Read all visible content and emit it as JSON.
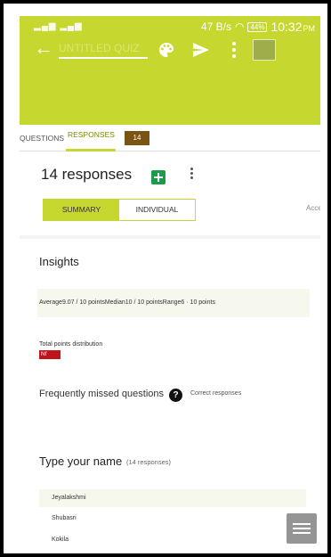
{
  "status": {
    "speed": "47 B/s",
    "battery": "44%",
    "time": "10:32",
    "ampm": "PM"
  },
  "toolbar": {
    "title": "UNTITLED QUIZ"
  },
  "tabs": {
    "questions": "QUESTIONS",
    "responses": "RESPONSES",
    "responses_count": "14"
  },
  "summary": {
    "heading": "14 responses",
    "summary_button": "SUMMARY",
    "individual_button": "INDIVIDUAL",
    "accepting_text": "Acce"
  },
  "insights": {
    "title": "Insights",
    "stats": "Average9.07 / 10 pointsMedian10 / 10 pointsRange6 · 10 points",
    "distribution_label": "Total points distribution",
    "nf_badge": "Nf",
    "missed_title": "Frequently missed questions",
    "correct_link": "Correct responses"
  },
  "question": {
    "title": "Type your name",
    "count": "(14 responses)",
    "answers": [
      "Jeyalakshmi",
      "Shubasri",
      "Kokila"
    ]
  },
  "colors": {
    "accent": "#c6d730",
    "badge": "#7a5410",
    "sheets": "#1a9c4a",
    "nf": "#c0141a"
  }
}
